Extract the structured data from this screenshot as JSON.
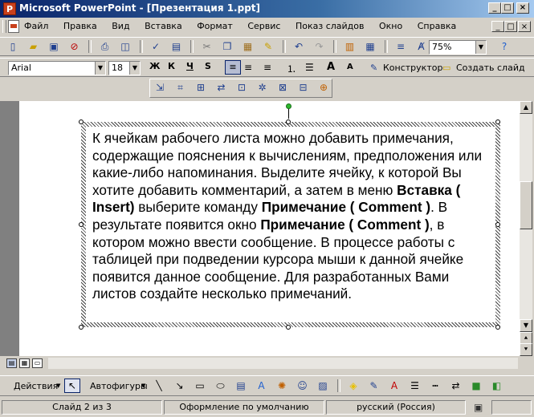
{
  "window": {
    "title": "Microsoft PowerPoint - [Презентация 1.ppt]",
    "app_icon_letter": "P",
    "controls": [
      "_",
      "□",
      "×"
    ]
  },
  "menubar": {
    "items": [
      "Файл",
      "Правка",
      "Вид",
      "Вставка",
      "Формат",
      "Сервис",
      "Показ слайдов",
      "Окно",
      "Справка"
    ],
    "mdi_controls": [
      "_",
      "□",
      "×"
    ]
  },
  "standard_toolbar": {
    "zoom": "75%"
  },
  "formatting_toolbar": {
    "font": "Arial",
    "size": "18",
    "bold": "Ж",
    "italic": "К",
    "underline": "Ч",
    "shadow": "S",
    "grow_font": "A",
    "shrink_font": "A",
    "designer": "Конструктор",
    "new_slide": "Создать слайд"
  },
  "slide": {
    "body_parts": [
      {
        "text": "К ячейкам рабочего листа можно добавить примечания, содержащие пояснения к вычислениям, предположения или какие-либо напоминания. Выделите ячейку, к которой Вы хотите добавить комментарий, а затем в меню ",
        "bold": false
      },
      {
        "text": "Вставка ( Insert)",
        "bold": true
      },
      {
        "text": " выберите команду ",
        "bold": false
      },
      {
        "text": "Примечание ( Comment )",
        "bold": true
      },
      {
        "text": ". В результате появится окно ",
        "bold": false
      },
      {
        "text": "Примечание ( Comment )",
        "bold": true
      },
      {
        "text": ", в котором можно ввести сообщение. В процессе работы с таблицей при подведении курсора мыши к данной ячейке появится данное сообщение. Для разработанных Вами листов создайте несколько примечаний.",
        "bold": false
      }
    ]
  },
  "drawing_toolbar": {
    "actions": "Действия",
    "autoshapes": "Автофигуры"
  },
  "statusbar": {
    "slide": "Слайд 2 из 3",
    "design": "Оформление по умолчанию",
    "language": "русский (Россия)"
  }
}
